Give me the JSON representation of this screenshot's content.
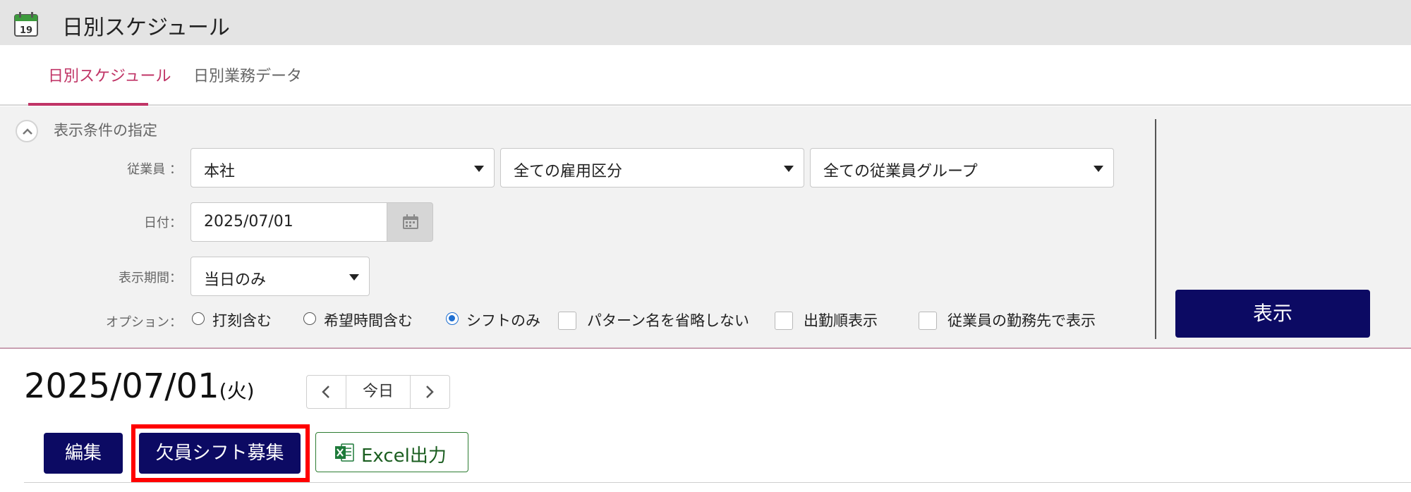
{
  "app": {
    "title": "日別スケジュール"
  },
  "tabs": [
    {
      "label": "日別スケジュール",
      "active": true
    },
    {
      "label": "日別業務データ",
      "active": false
    }
  ],
  "filter_panel": {
    "title": "表示条件の指定",
    "employee_label": "従業員 ：",
    "employee_selects": [
      "本社",
      "全ての雇用区分",
      "全ての従業員グループ"
    ],
    "date_label": "日付：",
    "date_value": "2025/07/01",
    "period_label": "表示期間：",
    "period_value": "当日のみ",
    "option_label": "オプション：",
    "radios": [
      {
        "label": "打刻含む",
        "selected": false
      },
      {
        "label": "希望時間含む",
        "selected": false
      },
      {
        "label": "シフトのみ",
        "selected": true
      }
    ],
    "checkboxes": [
      {
        "label": "パターン名を省略しない",
        "checked": false
      },
      {
        "label": "出勤順表示",
        "checked": false
      },
      {
        "label": "従業員の勤務先で表示",
        "checked": false
      }
    ],
    "show_button": "表示"
  },
  "main": {
    "date": "2025/07/01",
    "weekday": "(火)",
    "today_label": "今日",
    "buttons": {
      "edit": "編集",
      "recruit": "欠員シフト募集",
      "excel": "Excel出力"
    }
  },
  "colors": {
    "accent": "#c03466",
    "primary": "#0c0a63",
    "excel": "#2e7d32",
    "highlight": "#ff0000"
  }
}
